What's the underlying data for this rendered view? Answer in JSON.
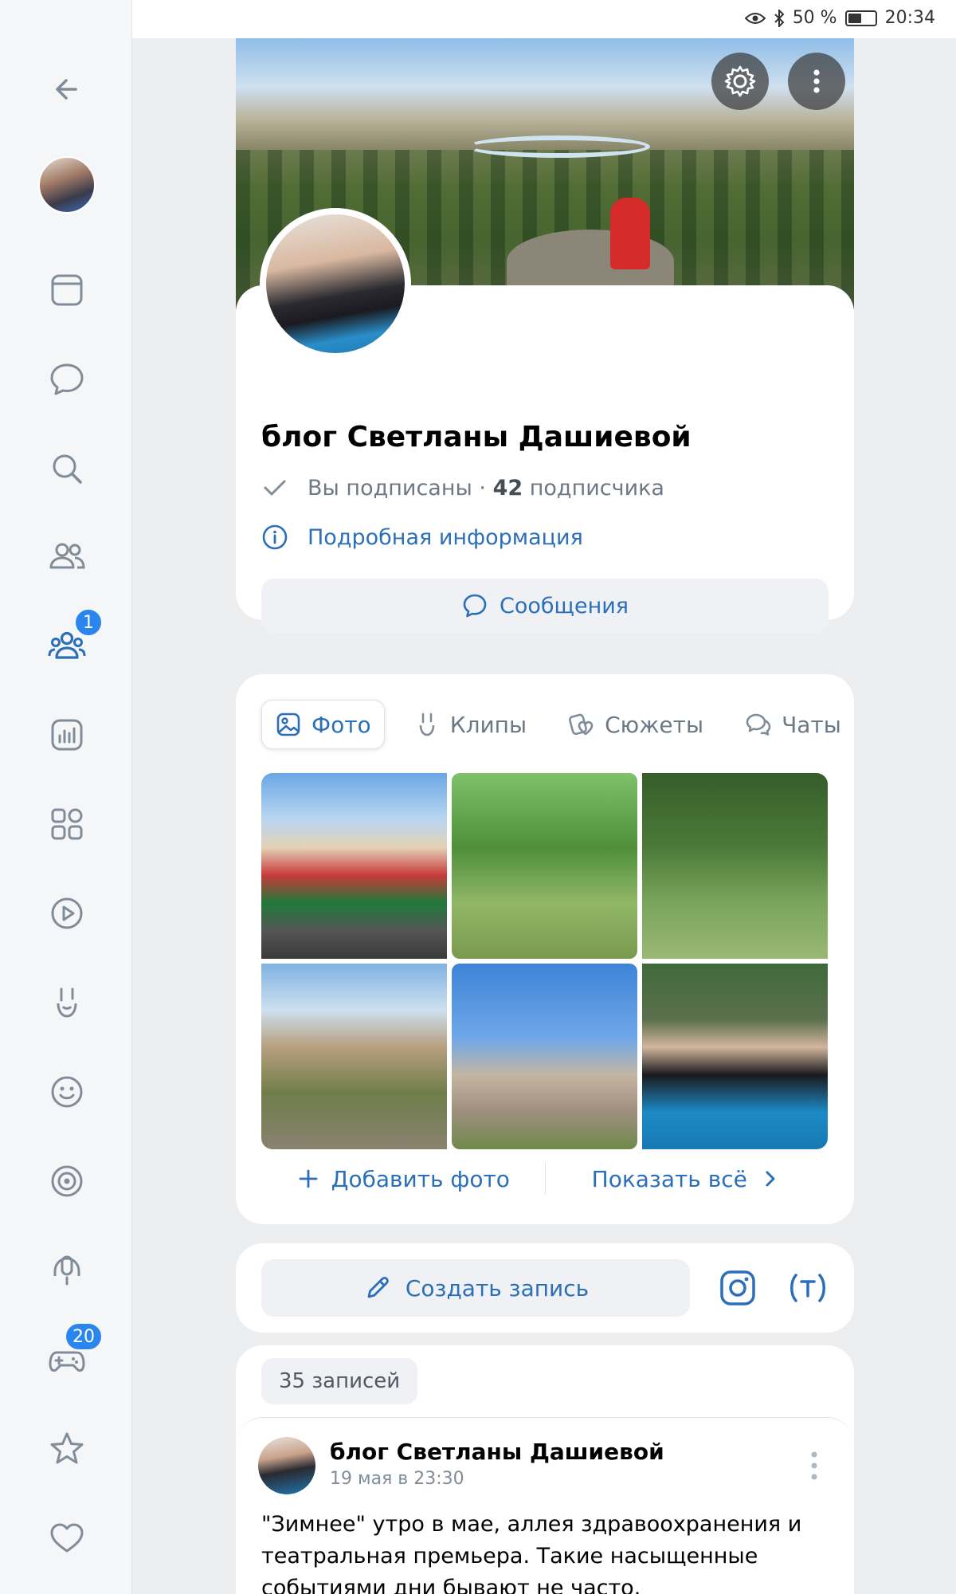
{
  "status_bar": {
    "battery": "50 %",
    "time": "20:34"
  },
  "sidebar": {
    "badges": {
      "communities": "1",
      "games": "20"
    }
  },
  "profile": {
    "name": "блог Светланы Дашиевой",
    "subscription_status": "Вы подписаны · ",
    "subscriber_count": "42",
    "subscriber_word": " подписчика",
    "details_link": "Подробная информация",
    "messages_button": "Сообщения"
  },
  "media": {
    "tabs": [
      {
        "label": "Фото"
      },
      {
        "label": "Клипы"
      },
      {
        "label": "Сюжеты"
      },
      {
        "label": "Чаты"
      }
    ],
    "add_photo": "Добавить фото",
    "show_all": "Показать всё"
  },
  "composer": {
    "create_post": "Создать запись"
  },
  "wall": {
    "post_count": "35 записей",
    "post": {
      "author": "блог Светланы Дашиевой",
      "date": "19 мая в 23:30",
      "text": "\"Зимнее\" утро в мае, аллея здравоохранения и театральная премьера. Такие насыщенные событиями дни бывают не часто."
    }
  },
  "colors": {
    "accent": "#2a6fb8",
    "badge": "#2a86ee",
    "muted_text": "#6d7885",
    "background": "#edeef0"
  }
}
